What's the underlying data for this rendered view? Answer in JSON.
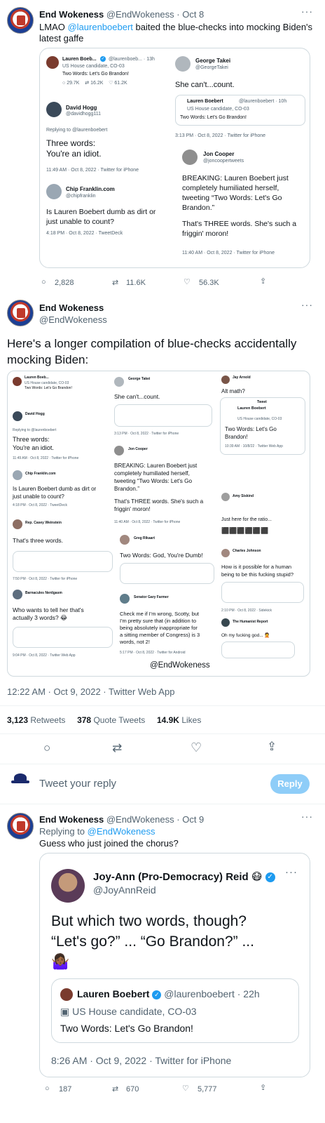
{
  "tweet1": {
    "name": "End Wokeness",
    "handle": "@EndWokeness",
    "date": "· Oct 8",
    "text_pre": "LMAO ",
    "mention": "@laurenboebert",
    "text_post": " baited the blue-checks into mocking Biden's latest gaffe",
    "replies": "2,828",
    "retweets": "11.6K",
    "likes": "56.3K"
  },
  "embed1": {
    "boebert_name": "Lauren Boeb...",
    "boebert_handle": "@laurenboeb... · 13h",
    "boebert_sub": "US House candidate, CO-03",
    "boebert_text": "Two Words: Let's Go Brandon!",
    "boebert_replies": "29.7K",
    "boebert_rts": "16.2K",
    "boebert_likes": "61.2K",
    "hogg_name": "David Hogg",
    "hogg_handle": "@davidhogg111",
    "replying_to": "Replying to @laurenboebert",
    "hogg_text1": "Three words:",
    "hogg_text2": "You're an idiot.",
    "hogg_time": "11:49 AM · Oct 8, 2022 · Twitter for iPhone",
    "franklin_name": "Chip Franklin.com",
    "franklin_handle": "@chipfranklin",
    "franklin_text1": "Is Lauren Boebert dumb as dirt or",
    "franklin_text2": "just unable to count?",
    "franklin_time": "4:18 PM · Oct 8, 2022 · TweetDeck",
    "takei_name": "George Takei",
    "takei_handle": "@GeorgeTakei",
    "takei_text": "She can't...count.",
    "q_name": "Lauren Boebert",
    "q_handle": "@laurenboebert · 10h",
    "q_sub": "US House candidate, CO-03",
    "q_text": "Two Words: Let's Go Brandon!",
    "takei_time": "3:13 PM · Oct 8, 2022 · Twitter for iPhone",
    "cooper_name": "Jon Cooper",
    "cooper_handle": "@joncoopertweets",
    "cooper_text1": "BREAKING: Lauren Boebert just",
    "cooper_text2": "completely humiliated herself,",
    "cooper_text3": "tweeting “Two Words: Let's Go",
    "cooper_text4": "Brandon.”",
    "cooper_text5": "That's THREE words. She's such a",
    "cooper_text6": "friggin' moron!",
    "cooper_time": "11:40 AM · Oct 8, 2022 · Twitter for iPhone"
  },
  "tweet2": {
    "name": "End Wokeness",
    "handle": "@EndWokeness",
    "text1": "Here's a longer compilation of blue-checks accidentally",
    "text2": "mocking Biden:",
    "time": "12:22 AM · Oct 9, 2022 · Twitter Web App",
    "retweets_count": "3,123",
    "retweets_label": "Retweets",
    "quotes_count": "378",
    "quotes_label": "Quote Tweets",
    "likes_count": "14.9K",
    "likes_label": "Likes"
  },
  "collage": {
    "watermark": "@EndWokeness",
    "col1": {
      "boebert_name": "Lauren Boeb...",
      "boebert_sub": "US House candidate, CO-03",
      "boebert_text": "Two Words: Let's Go Brandon!",
      "hogg_name": "David Hogg",
      "replying": "Replying to @laurenboebert",
      "hogg_text1": "Three words:",
      "hogg_text2": "You're an idiot.",
      "hogg_time": "11:49 AM · Oct 8, 2022 · Twitter for iPhone",
      "franklin_name": "Chip Franklin.com",
      "franklin_text1": "Is Lauren Boebert dumb as dirt or",
      "franklin_text2": "just unable to count?",
      "franklin_time": "4:18 PM · Oct 8, 2022 · TweetDeck",
      "weinstein_name": "Rep. Casey Weinstein",
      "weinstein_text": "That's three words.",
      "weinstein_time": "7:50 PM · Oct 8, 2022 · Twitter for iPhone",
      "nerdgasm_name": "Barnacules Nerdgasm",
      "nerdgasm_text1": "Who wants to tell her that's",
      "nerdgasm_text2": "actually 3 words? 😂",
      "nerdgasm_time": "9:04 PM · Oct 8, 2022 · Twitter Web App"
    },
    "col2": {
      "takei_name": "George Takei",
      "takei_text": "She can't...count.",
      "takei_time": "3:13 PM · Oct 8, 2022 · Twitter for iPhone",
      "cooper_name": "Jon Cooper",
      "cooper_text1": "BREAKING: Lauren Boebert just",
      "cooper_text2": "completely humiliated herself,",
      "cooper_text3": "tweeting “Two Words: Let's Go",
      "cooper_text4": "Brandon.”",
      "cooper_text5": "That's THREE words. She's such a",
      "cooper_text6": "friggin' moron!",
      "cooper_time": "11:40 AM · Oct 8, 2022 · Twitter for iPhone",
      "rikaart_name": "Greg Rikaart",
      "rikaart_text": "Two Words: God, You're Dumb!",
      "farmer_name": "Senator Gary Farmer",
      "farmer_text1": "Check me if I'm wrong, Scotty, but",
      "farmer_text2": "I'm pretty sure that (in addition to",
      "farmer_text3": "being absolutely inappropriate for",
      "farmer_text4": "a sitting member of Congress) is 3",
      "farmer_text5": "words, not 2!",
      "farmer_time": "5:17 PM · Oct 8, 2022 · Twitter for Android"
    },
    "col3": {
      "arnold_name": "Jay Arnold",
      "arnold_text": "Alt math?",
      "tweet_label": "Tweet",
      "boebert_name": "Lauren Boebert",
      "boebert_sub": "US House candidate, CO-03",
      "boebert_text1": "Two Words: Let's Go",
      "boebert_text2": "Brandon!",
      "boebert_time": "10:39 AM · 10/8/22 · Twitter Web App",
      "siskind_name": "Amy Siskind",
      "siskind_text": "Just here for the ratio...",
      "johnson_name": "Charles Johnson",
      "johnson_text1": "How is it possible for a human",
      "johnson_text2": "being to be this fucking stupid?",
      "johnson_time": "2:10 PM · Oct 8, 2022 · Sidekick",
      "humanist_name": "The Humanist Report",
      "humanist_text": "Oh my fucking god... 🤦"
    }
  },
  "reply_box": {
    "placeholder": "Tweet your reply",
    "button": "Reply"
  },
  "tweet3": {
    "name": "End Wokeness",
    "handle": "@EndWokeness",
    "date": "· Oct 9",
    "replying_pre": "Replying to ",
    "replying_handle": "@EndWokeness",
    "text": "Guess who just joined the chorus?"
  },
  "embed3": {
    "name": "Joy-Ann (Pro-Democracy) Reid 😷",
    "handle": "@JoyAnnReid",
    "text1": "But which two words, though?",
    "text2": "“Let's go?” ... “Go Brandon?” ...",
    "emoji": "🤷🏾‍♀️",
    "q_name": "Lauren Boebert",
    "q_handle": "@laurenboebert · 22h",
    "q_sub": "US House candidate, CO-03",
    "q_text": "Two Words: Let's Go Brandon!",
    "time": "8:26 AM · Oct 9, 2022 · Twitter for iPhone",
    "replies": "187",
    "retweets": "670",
    "likes": "5,777"
  }
}
